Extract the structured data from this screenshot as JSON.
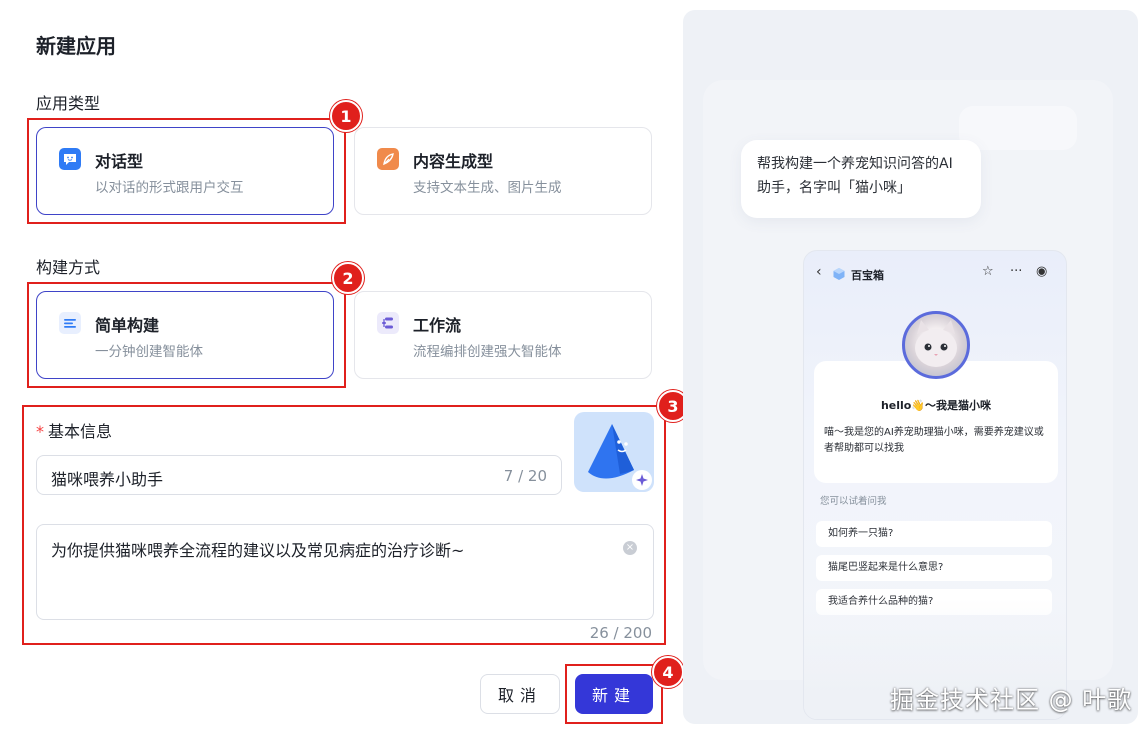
{
  "dialog": {
    "title": "新建应用"
  },
  "app_type": {
    "label": "应用类型",
    "options": [
      {
        "title": "对话型",
        "desc": "以对话的形式跟用户交互",
        "selected": true,
        "icon": "chat-icon",
        "color": "#2f7bf5"
      },
      {
        "title": "内容生成型",
        "desc": "支持文本生成、图片生成",
        "selected": false,
        "icon": "feather-icon",
        "color": "#f08a4b"
      }
    ]
  },
  "build_method": {
    "label": "构建方式",
    "options": [
      {
        "title": "简单构建",
        "desc": "一分钟创建智能体",
        "selected": true,
        "icon": "list-icon",
        "color": "#2f7bf5"
      },
      {
        "title": "工作流",
        "desc": "流程编排创建强大智能体",
        "selected": false,
        "icon": "workflow-icon",
        "color": "#6b5bd6"
      }
    ]
  },
  "basic_info": {
    "label": "基本信息",
    "required_mark": "*",
    "name_value": "猫咪喂养小助手",
    "name_count": "7 / 20",
    "desc_value": "为你提供猫咪喂养全流程的建议以及常见病症的治疗诊断~",
    "desc_count": "26 / 200"
  },
  "actions": {
    "cancel": "取消",
    "create": "新建"
  },
  "badges": [
    "1",
    "2",
    "3",
    "4"
  ],
  "preview": {
    "prompt": "帮我构建一个养宠知识问答的AI助手，名字叫「猫小咪」",
    "app_name": "百宝箱",
    "hello": "hello👋～我是猫小咪",
    "intro": "喵～我是您的AI养宠助理猫小咪，需要养宠建议或者帮助都可以找我",
    "ask_label": "您可以试着问我",
    "questions": [
      "如何养一只猫?",
      "猫尾巴竖起来是什么意思?",
      "我适合养什么品种的猫?"
    ]
  },
  "watermark": "掘金技术社区 @ 叶歌",
  "colors": {
    "accent": "#3437d8",
    "highlight_red": "#e0201c",
    "selected_border": "#3f44c8"
  }
}
